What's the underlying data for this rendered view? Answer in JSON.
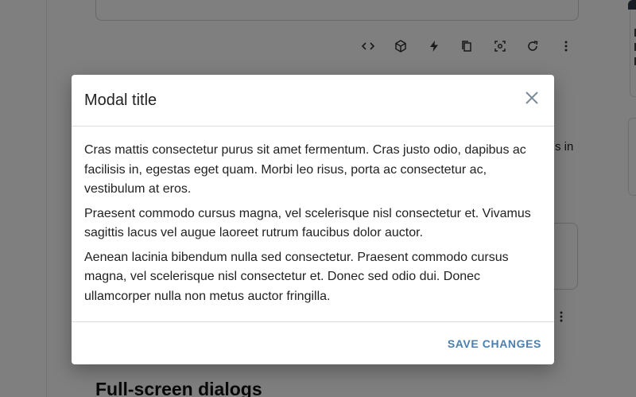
{
  "background": {
    "partial_text_right": "s in",
    "section_heading": "Full-screen dialogs",
    "toolbar_icons": [
      "code-icon",
      "cube-icon",
      "bolt-icon",
      "copy-icon",
      "screenshot-icon",
      "refresh-icon",
      "more-vertical-icon"
    ]
  },
  "modal": {
    "title": "Modal title",
    "close_icon": "close-icon",
    "paragraphs": [
      "Cras mattis consectetur purus sit amet fermentum. Cras justo odio, dapibus ac facilisis in, egestas eget quam. Morbi leo risus, porta ac consectetur ac, vestibulum at eros.",
      "Praesent commodo cursus magna, vel scelerisque nisl consectetur et. Vivamus sagittis lacus vel augue laoreet rutrum faucibus dolor auctor.",
      "Aenean lacinia bibendum nulla sed consectetur. Praesent commodo cursus magna, vel scelerisque nisl consectetur et. Donec sed odio dui. Donec ullamcorper nulla non metus auctor fringilla."
    ],
    "save_label": "SAVE CHANGES"
  },
  "colors": {
    "accent": "#4a7fb0",
    "backdrop": "rgba(0,0,0,0.5)"
  }
}
